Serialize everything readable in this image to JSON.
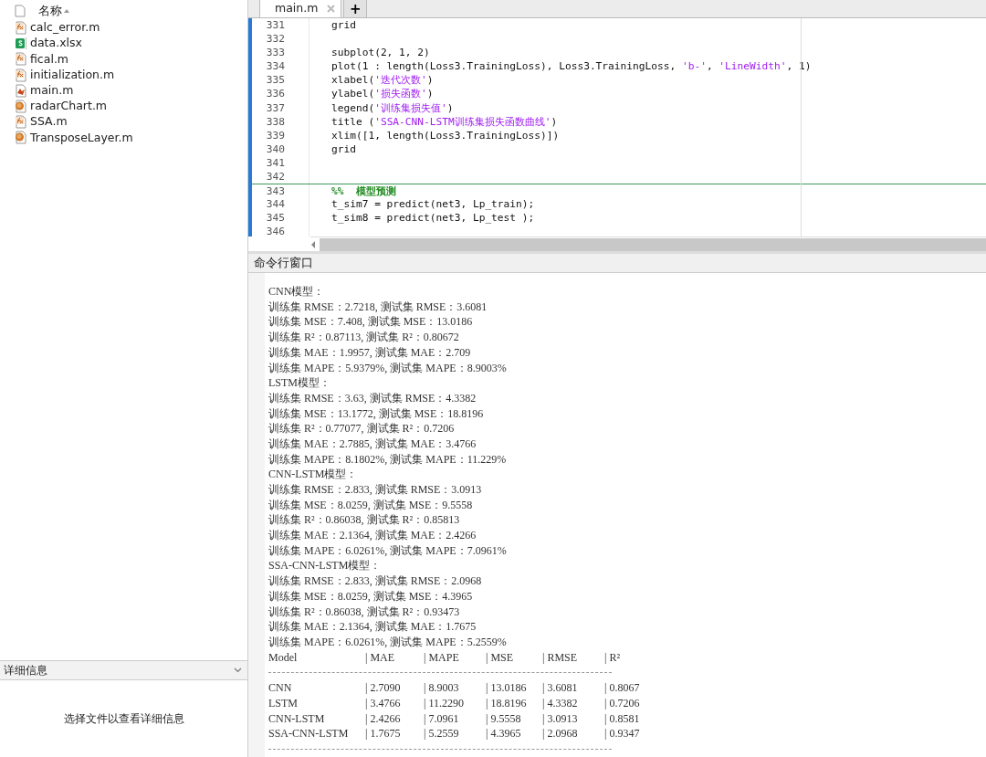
{
  "file_browser": {
    "column_header": "名称",
    "files": [
      {
        "name": "calc_error.m",
        "kind": "function"
      },
      {
        "name": "data.xlsx",
        "kind": "sheet"
      },
      {
        "name": "fical.m",
        "kind": "function"
      },
      {
        "name": "initialization.m",
        "kind": "function"
      },
      {
        "name": "main.m",
        "kind": "script"
      },
      {
        "name": "radarChart.m",
        "kind": "class"
      },
      {
        "name": "SSA.m",
        "kind": "function"
      },
      {
        "name": "TransposeLayer.m",
        "kind": "class"
      }
    ]
  },
  "details_panel": {
    "title": "详细信息",
    "message": "选择文件以查看详细信息"
  },
  "editor": {
    "tabs": [
      {
        "label": "main.m",
        "selected": true
      }
    ],
    "add_tab": "+",
    "lines": [
      {
        "number": "331",
        "segments": [
          {
            "kind": "code",
            "text": "grid"
          }
        ]
      },
      {
        "number": "332"
      },
      {
        "number": "333",
        "segments": [
          {
            "kind": "code",
            "text": "subplot(2, 1, 2)"
          }
        ]
      },
      {
        "number": "334",
        "segments": [
          {
            "kind": "code",
            "text": "plot(1 : length(Loss3.TrainingLoss), Loss3.TrainingLoss, "
          },
          {
            "kind": "string",
            "text": "'b-'"
          },
          {
            "kind": "code",
            "text": ", "
          },
          {
            "kind": "string",
            "text": "'LineWidth'"
          },
          {
            "kind": "code",
            "text": ", 1)"
          }
        ]
      },
      {
        "number": "335",
        "segments": [
          {
            "kind": "code",
            "text": "xlabel("
          },
          {
            "kind": "string",
            "text": "'迭代次数'"
          },
          {
            "kind": "code",
            "text": ")"
          }
        ]
      },
      {
        "number": "336",
        "segments": [
          {
            "kind": "code",
            "text": "ylabel("
          },
          {
            "kind": "string",
            "text": "'损失函数'"
          },
          {
            "kind": "code",
            "text": ")"
          }
        ]
      },
      {
        "number": "337",
        "segments": [
          {
            "kind": "code",
            "text": "legend("
          },
          {
            "kind": "string",
            "text": "'训练集损失值'"
          },
          {
            "kind": "code",
            "text": ")"
          }
        ]
      },
      {
        "number": "338",
        "segments": [
          {
            "kind": "code",
            "text": "title ("
          },
          {
            "kind": "string",
            "text": "'SSA-CNN-LSTM训练集损失函数曲线'"
          },
          {
            "kind": "code",
            "text": ")"
          }
        ]
      },
      {
        "number": "339",
        "segments": [
          {
            "kind": "code",
            "text": "xlim([1, length(Loss3.TrainingLoss)])"
          }
        ]
      },
      {
        "number": "340",
        "segments": [
          {
            "kind": "code",
            "text": "grid"
          }
        ]
      },
      {
        "number": "341"
      },
      {
        "number": "342"
      },
      {
        "number": "343",
        "segments": [
          {
            "kind": "comment",
            "text": "%%  模型预测"
          }
        ]
      },
      {
        "number": "344",
        "segments": [
          {
            "kind": "code",
            "text": "t_sim7 = predict(net3, Lp_train);"
          }
        ]
      },
      {
        "number": "345",
        "segments": [
          {
            "kind": "code",
            "text": "t_sim8 = predict(net3, Lp_test );"
          }
        ]
      },
      {
        "number": "346"
      }
    ]
  },
  "command_window": {
    "title": "命令行窗口",
    "lines": [
      "CNN模型：",
      "训练集 RMSE：2.7218, 测试集 RMSE：3.6081",
      "训练集 MSE：7.408, 测试集 MSE：13.0186",
      "训练集 R²：0.87113, 测试集 R²：0.80672",
      "训练集 MAE：1.9957, 测试集 MAE：2.709",
      "训练集 MAPE：5.9379%, 测试集 MAPE：8.9003%",
      "LSTM模型：",
      "训练集 RMSE：3.63, 测试集 RMSE：4.3382",
      "训练集 MSE：13.1772, 测试集 MSE：18.8196",
      "训练集 R²：0.77077, 测试集 R²：0.7206",
      "训练集 MAE：2.7885, 测试集 MAE：3.4766",
      "训练集 MAPE：8.1802%, 测试集 MAPE：11.229%",
      "CNN-LSTM模型：",
      "训练集 RMSE：2.833, 测试集 RMSE：3.0913",
      "训练集 MSE：8.0259, 测试集 MSE：9.5558",
      "训练集 R²：0.86038, 测试集 R²：0.85813",
      "训练集 MAE：2.1364, 测试集 MAE：2.4266",
      "训练集 MAPE：6.0261%, 测试集 MAPE：7.0961%",
      "SSA-CNN-LSTM模型：",
      "训练集 RMSE：2.833, 测试集 RMSE：2.0968",
      "训练集 MSE：8.0259, 测试集 MSE：4.3965",
      "训练集 R²：0.86038, 测试集 R²：0.93473",
      "训练集 MAE：2.1364, 测试集 MAE：1.7675",
      "训练集 MAPE：6.0261%, 测试集 MAPE：5.2559%"
    ],
    "table": {
      "columns": [
        "Model",
        "| MAE",
        "| MAPE",
        "| MSE",
        "| RMSE",
        "| R²"
      ],
      "rows": [
        [
          "CNN",
          "| 2.7090",
          "| 8.9003",
          "| 13.0186",
          "| 3.6081",
          "| 0.8067"
        ],
        [
          "LSTM",
          "| 3.4766",
          "| 11.2290",
          "| 18.8196",
          "| 4.3382",
          "| 0.7206"
        ],
        [
          "CNN-LSTM",
          "| 2.4266",
          "| 7.0961",
          "| 9.5558",
          "| 3.0913",
          "| 0.8581"
        ],
        [
          "SSA-CNN-LSTM",
          "| 1.7675",
          "| 5.2559",
          "| 4.3965",
          "| 2.0968",
          "| 0.9347"
        ]
      ]
    }
  }
}
